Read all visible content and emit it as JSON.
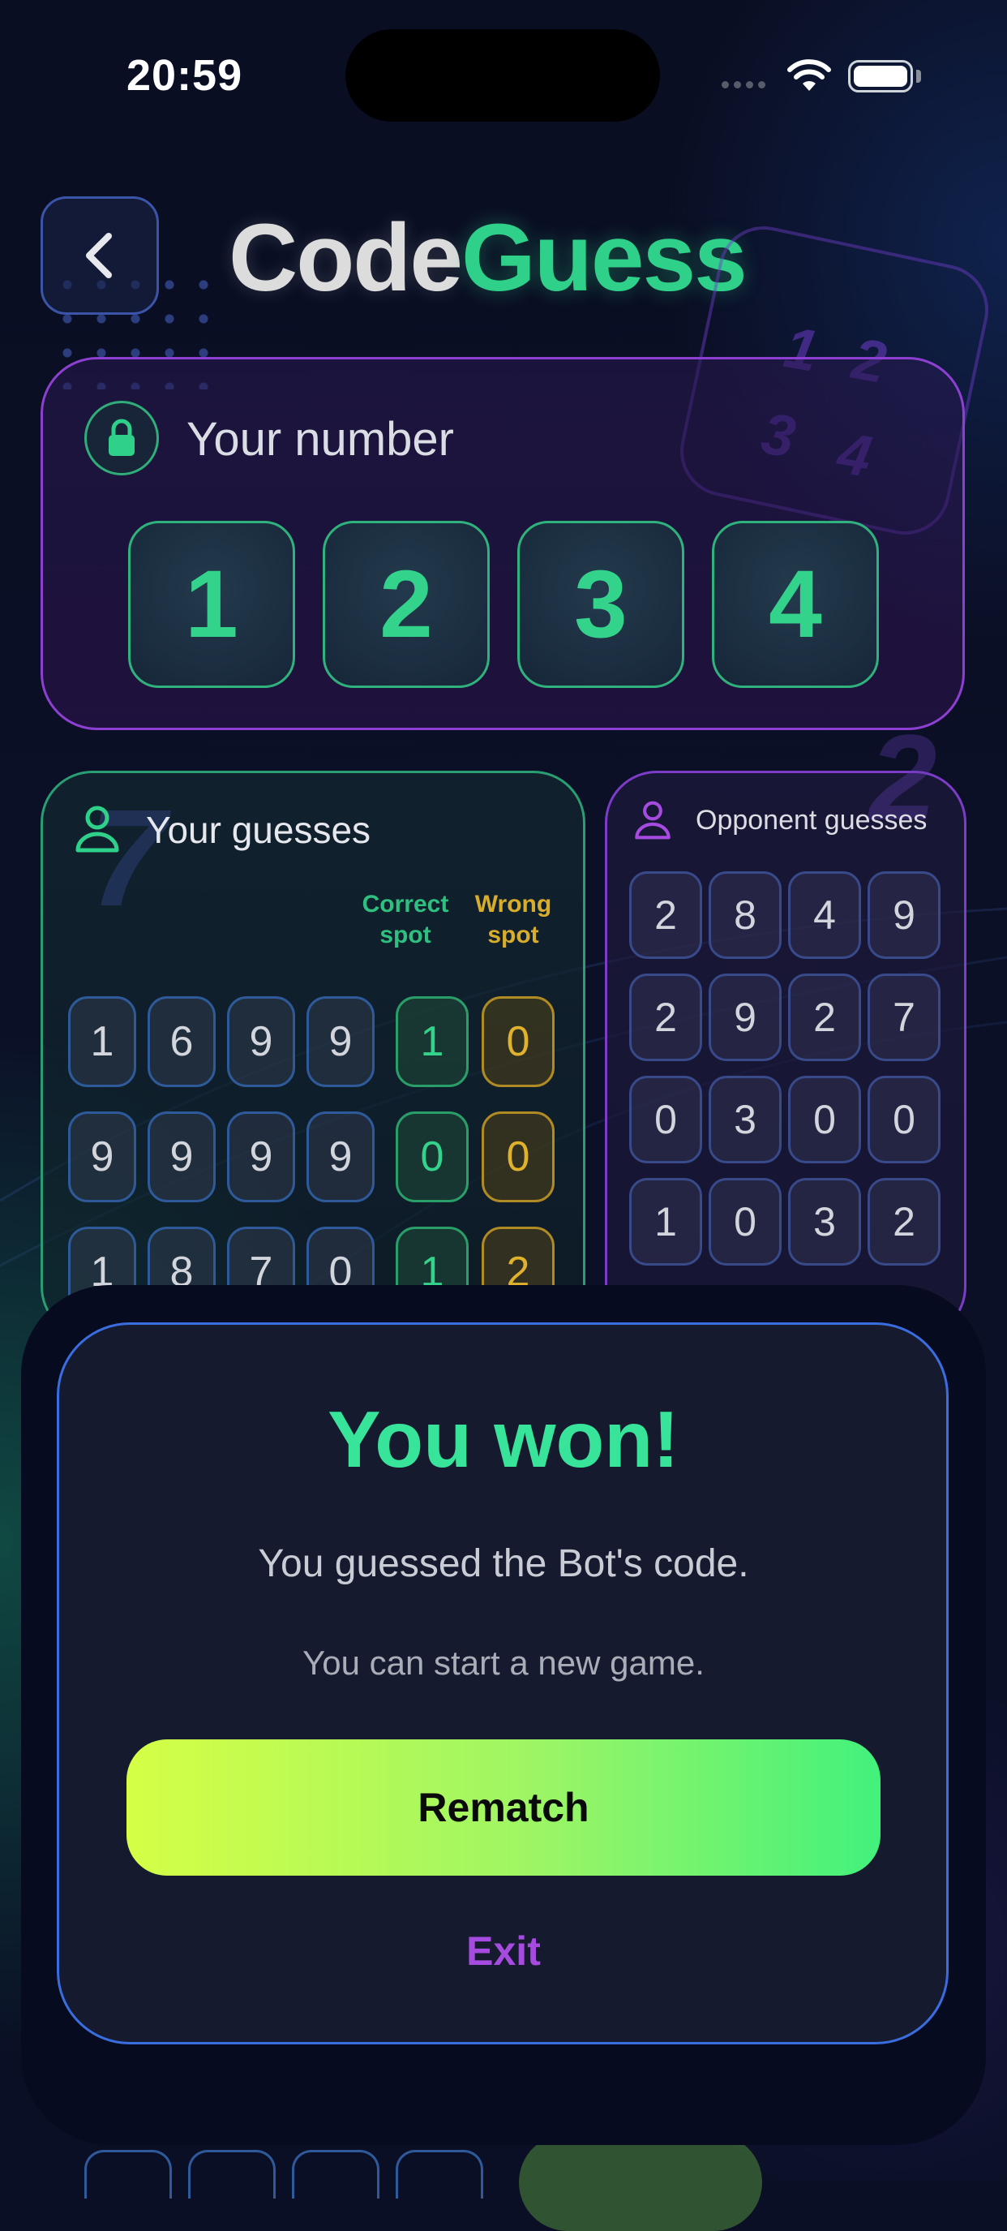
{
  "status_bar": {
    "time": "20:59"
  },
  "header": {
    "title_part1": "Code",
    "title_part2": "Guess"
  },
  "decor": {
    "card_digits": [
      "1",
      "2",
      "3",
      "4"
    ],
    "big_left": "7",
    "big_right": "2"
  },
  "your_number": {
    "label": "Your number",
    "digits": [
      "1",
      "2",
      "3",
      "4"
    ]
  },
  "your_guesses": {
    "label": "Your guesses",
    "col_correct": "Correct spot",
    "col_wrong": "Wrong spot",
    "rows": [
      {
        "digits": [
          "1",
          "6",
          "9",
          "9"
        ],
        "correct": "1",
        "wrong": "0"
      },
      {
        "digits": [
          "9",
          "9",
          "9",
          "9"
        ],
        "correct": "0",
        "wrong": "0"
      },
      {
        "digits": [
          "1",
          "8",
          "7",
          "0"
        ],
        "correct": "1",
        "wrong": "2"
      }
    ]
  },
  "opponent_guesses": {
    "label": "Opponent guesses",
    "rows": [
      [
        "2",
        "8",
        "4",
        "9"
      ],
      [
        "2",
        "9",
        "2",
        "7"
      ],
      [
        "0",
        "3",
        "0",
        "0"
      ],
      [
        "1",
        "0",
        "3",
        "2"
      ]
    ]
  },
  "modal": {
    "title": "You won!",
    "message": "You guessed the Bot's code.",
    "hint": "You can start a new game.",
    "rematch_label": "Rematch",
    "exit_label": "Exit"
  },
  "colors": {
    "accent_green": "#34d38c",
    "accent_purple": "#8c3fd1",
    "wrong_yellow": "#e0b22c",
    "exit_purple": "#a64be0"
  }
}
